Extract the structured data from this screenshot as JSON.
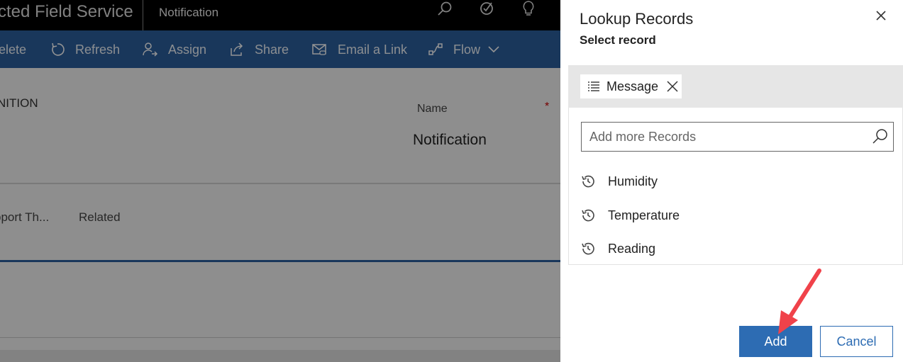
{
  "topbar": {
    "app_title": "cted Field Service",
    "entity_name": "Notification",
    "icons": [
      "search-icon",
      "task-check-icon",
      "lightbulb-icon"
    ]
  },
  "command_bar": {
    "items": [
      {
        "label": "elete",
        "icon": "delete-icon"
      },
      {
        "label": "Refresh",
        "icon": "refresh-icon"
      },
      {
        "label": "Assign",
        "icon": "assign-icon"
      },
      {
        "label": "Share",
        "icon": "share-icon"
      },
      {
        "label": "Email a Link",
        "icon": "email-link-icon"
      },
      {
        "label": "Flow",
        "icon": "flow-icon"
      }
    ]
  },
  "form": {
    "section_title": "NITION",
    "name_label": "Name",
    "required_marker": "*",
    "name_value": "Notification",
    "tabs": [
      "pport Th...",
      "Related"
    ]
  },
  "lookup": {
    "title": "Lookup Records",
    "subtitle": "Select record",
    "chip_label": "Message",
    "search_placeholder": "Add more Records",
    "records": [
      "Humidity",
      "Temperature",
      "Reading"
    ],
    "add_label": "Add",
    "cancel_label": "Cancel"
  },
  "colors": {
    "command_bar": "#2b5f9e",
    "primary_button": "#2d6cb3",
    "annotation_arrow": "#f0424a"
  }
}
